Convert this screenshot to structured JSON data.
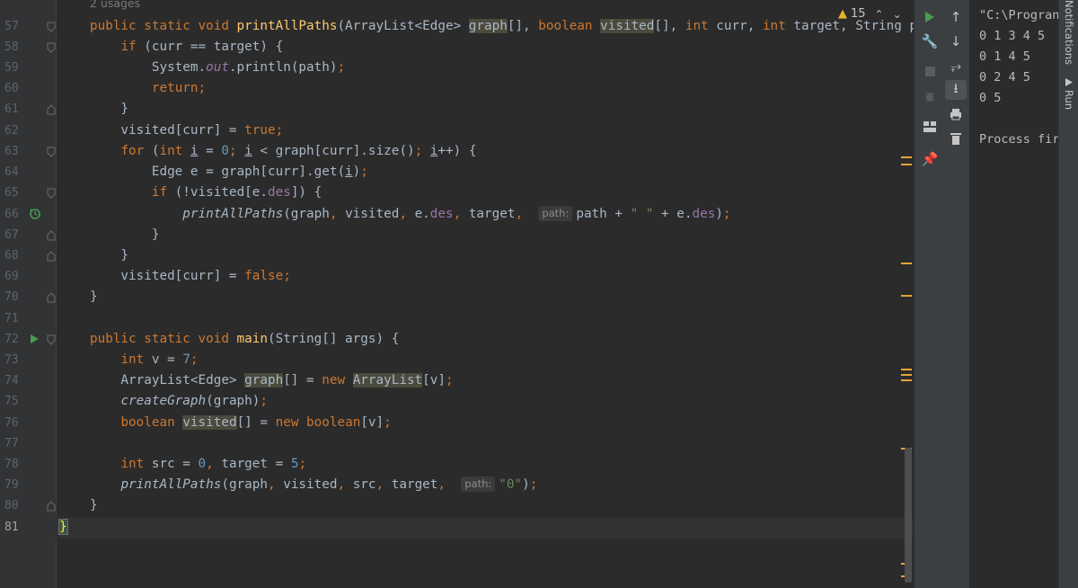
{
  "editor": {
    "usages_hint": "2 usages",
    "line_numbers": [
      "57",
      "58",
      "59",
      "60",
      "61",
      "62",
      "63",
      "64",
      "65",
      "66",
      "67",
      "68",
      "69",
      "70",
      "71",
      "72",
      "73",
      "74",
      "75",
      "76",
      "77",
      "78",
      "79",
      "80",
      "81"
    ],
    "current_line": "81",
    "inspections": {
      "warning_count": "15",
      "warning_icon": "warning-triangle-icon"
    },
    "param_hint_label": "path:"
  },
  "run_toolbar": {
    "buttons": [
      "rerun-icon",
      "up-arrow-icon",
      "down-arrow-icon",
      "wrench-icon",
      "soft-wrap-icon",
      "stop-icon",
      "scroll-to-end-icon",
      "debug-icon",
      "print-icon",
      "layout-icon",
      "trash-icon",
      "pin-icon"
    ]
  },
  "console": {
    "lines": [
      "\"C:\\Progran",
      "0 1 3 4 5",
      "0 1 4 5",
      "0 2 4 5",
      "0 5",
      "",
      "Process fir"
    ]
  },
  "side_tabs": {
    "notifications": "Notifications",
    "run": "Run"
  },
  "colors": {
    "keyword": "#cc7832",
    "number": "#6897bb",
    "string": "#6a8759",
    "method_decl": "#ffc66d",
    "field": "#9876aa",
    "warning_marker": "#e5a43a",
    "run_green": "#499c54"
  }
}
